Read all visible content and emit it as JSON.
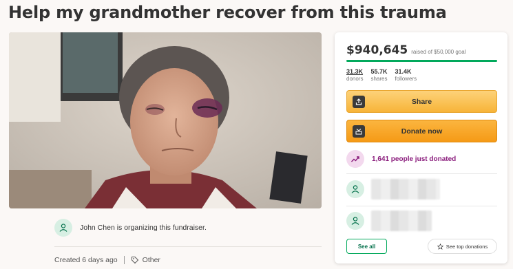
{
  "page": {
    "title": "Help my grandmother recover from this trauma"
  },
  "organizer": {
    "text": "John Chen is organizing this fundraiser."
  },
  "meta": {
    "created": "Created 6 days ago",
    "category": "Other"
  },
  "donation_card": {
    "raised_amount": "$940,645",
    "goal_text": "raised of $50,000 goal",
    "progress_fraction": 1.0,
    "stats": [
      {
        "value": "31.3K",
        "label": "donors"
      },
      {
        "value": "55.7K",
        "label": "shares"
      },
      {
        "value": "31.4K",
        "label": "followers"
      }
    ],
    "share_label": "Share",
    "donate_label": "Donate now",
    "trend_text": "1,641 people just donated",
    "see_all_label": "See all",
    "see_top_label": "See top donations"
  },
  "colors": {
    "brand_green": "#02a95c",
    "button_yellow": "#f7b438",
    "button_orange": "#f59a16",
    "trend_purple": "#8a1c7c"
  },
  "icons": {
    "share": "share-icon",
    "donate": "donate-icon",
    "trend": "trending-up-icon",
    "person": "person-icon",
    "tag": "tag-icon",
    "star": "star-icon"
  }
}
